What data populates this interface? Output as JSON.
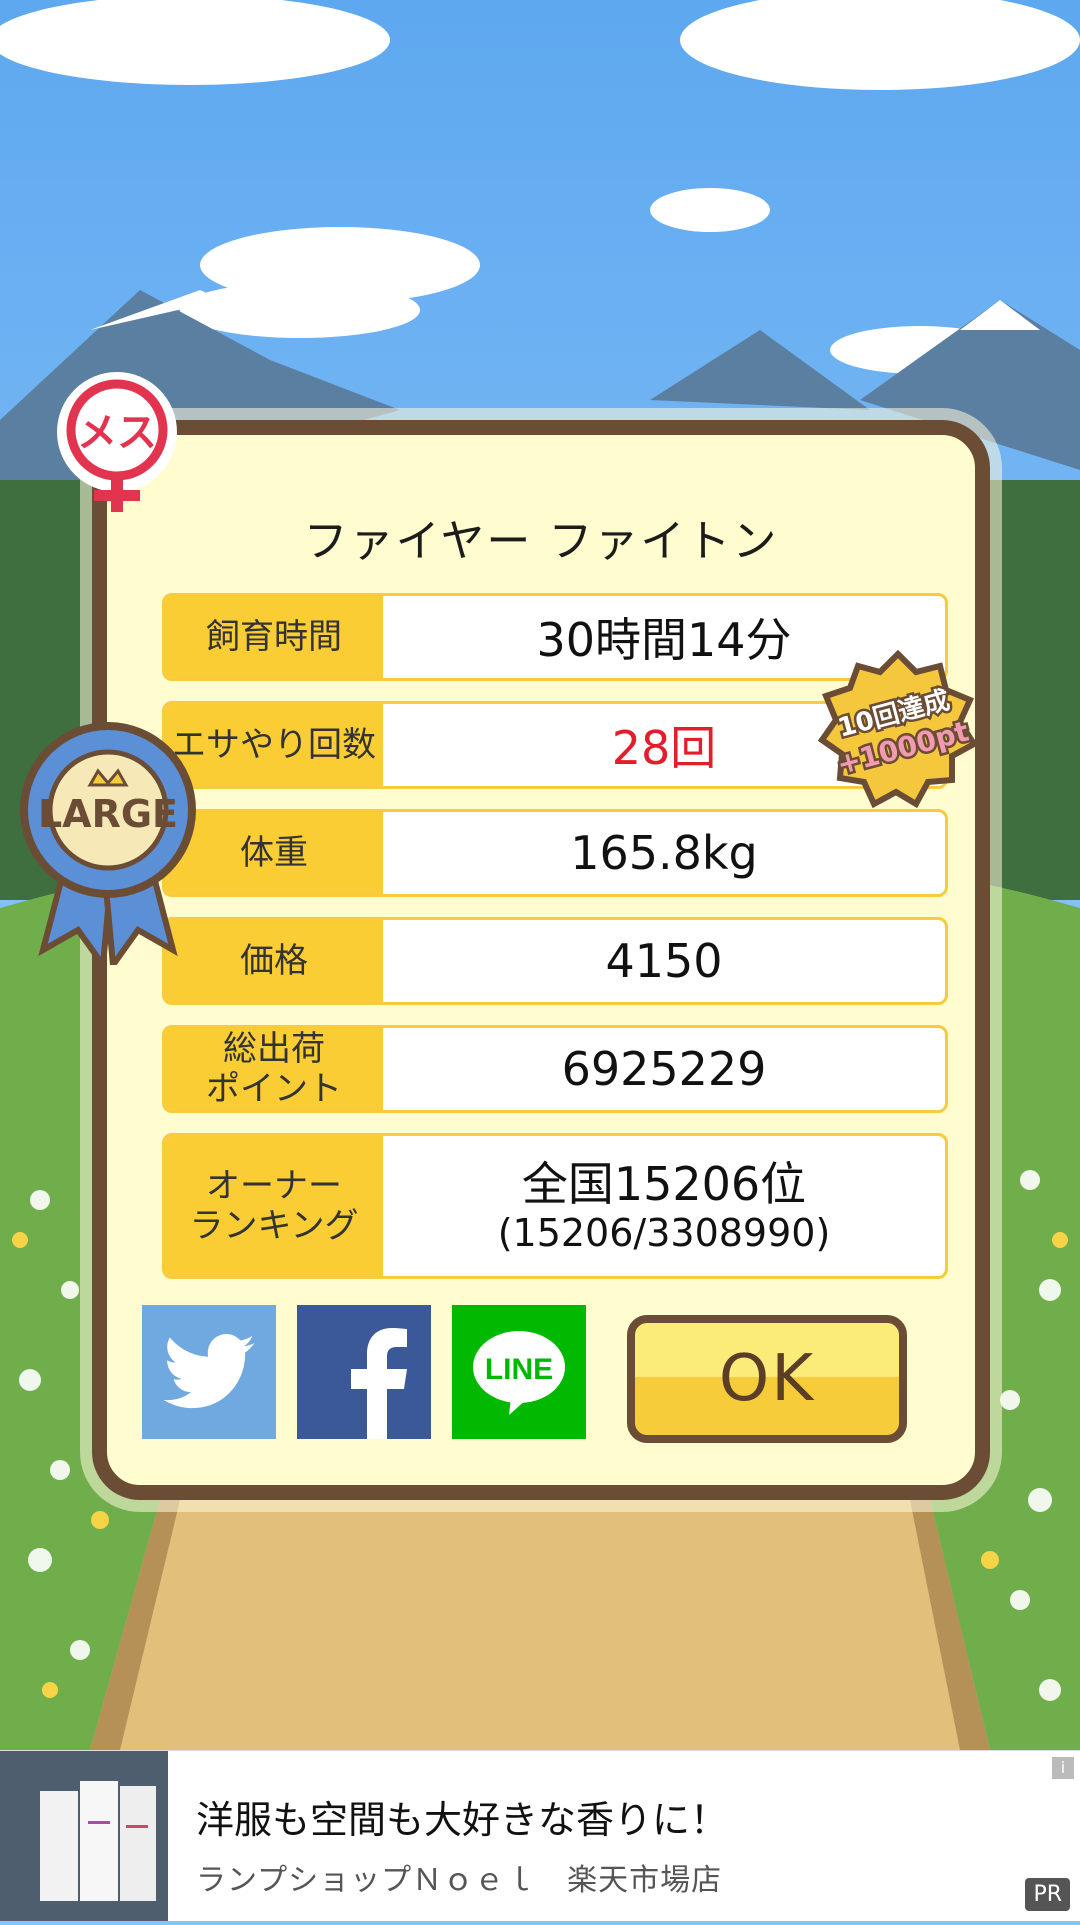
{
  "title": "ファイヤー ファイトン",
  "stats": [
    {
      "label": "飼育時間",
      "value": "30時間14分"
    },
    {
      "label": "エサやり回数",
      "value": "28回"
    },
    {
      "label": "体重",
      "value": "165.8kg"
    },
    {
      "label": "価格",
      "value": "4150"
    },
    {
      "label": "総出荷\nポイント",
      "value": "6925229"
    },
    {
      "label": "オーナー\nランキング",
      "value": "全国15206位",
      "sub": "(15206/3308990)"
    }
  ],
  "badges": {
    "gender": "メス",
    "size": "LARGE",
    "bonus_line1": "10回達成",
    "bonus_line2": "+1000pt"
  },
  "share": {
    "twitter": "twitter-share",
    "facebook": "f",
    "line": "LINE"
  },
  "ok_label": "OK",
  "ad": {
    "title": "洋服も空間も大好きな香りに！",
    "subtitle": "ランプショップＮｏｅｌ　楽天市場店",
    "info": "i",
    "pr": "PR"
  },
  "colors": {
    "frame": "#6b4c34",
    "label_bg": "#f9cd33",
    "panel_bg": "#fffcd0",
    "accent_red": "#e41d2a",
    "twitter": "#6fa9e0",
    "facebook": "#3b5998",
    "line": "#00b900"
  }
}
